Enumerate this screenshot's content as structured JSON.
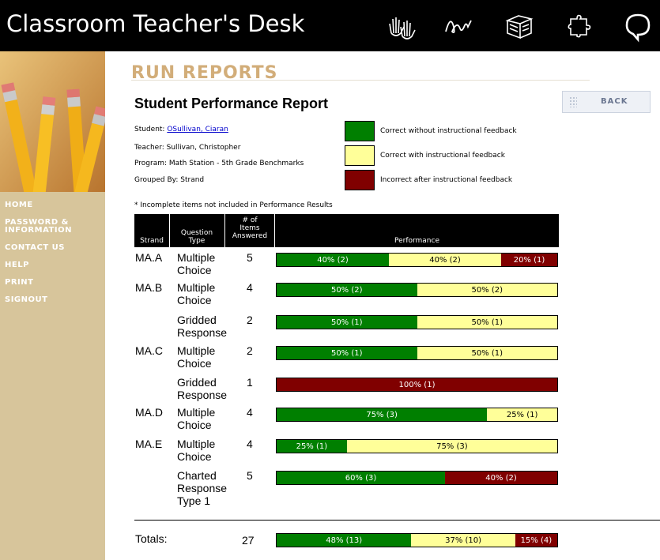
{
  "header": {
    "title": "Classroom Teacher's Desk",
    "icons": [
      "hands-icon",
      "signature-icon",
      "books-icon",
      "puzzle-icon",
      "speech-bubble-icon"
    ]
  },
  "sidebar": {
    "items": [
      {
        "label": "HOME"
      },
      {
        "label": "PASSWORD & INFORMATION"
      },
      {
        "label": "CONTACT US"
      },
      {
        "label": "HELP"
      },
      {
        "label": "PRINT"
      },
      {
        "label": "SIGNOUT"
      }
    ]
  },
  "page": {
    "section_title": "RUN REPORTS",
    "report_title": "Student Performance Report",
    "back_label": "BACK"
  },
  "meta": {
    "student_label": "Student:",
    "student_name": "OSullivan, Ciaran",
    "teacher": "Teacher: Sullivan, Christopher",
    "program": "Program: Math Station - 5th Grade Benchmarks",
    "grouped_by": "Grouped By: Strand",
    "note": "* Incomplete items not included in Performance Results"
  },
  "legend": [
    {
      "label": "Correct without instructional feedback",
      "color": "#007f00"
    },
    {
      "label": "Correct with instructional feedback",
      "color": "#ffff99"
    },
    {
      "label": "Incorrect after instructional feedback",
      "color": "#800000"
    }
  ],
  "colors": {
    "green": "#007f00",
    "yellow": "#ffff99",
    "red": "#800000"
  },
  "table": {
    "headers": {
      "strand": "Strand",
      "question_type_1": "Question",
      "question_type_2": "Type",
      "items_1": "# of",
      "items_2": "Items",
      "items_3": "Answered",
      "performance": "Performance"
    },
    "rows": [
      {
        "strand": "MA.A",
        "type": [
          "Multiple",
          "Choice"
        ],
        "count": "5",
        "segments": [
          {
            "pct": 40,
            "label": "40%  (2)",
            "kind": "green"
          },
          {
            "pct": 40,
            "label": "40%  (2)",
            "kind": "yellow"
          },
          {
            "pct": 20,
            "label": "20%  (1)",
            "kind": "red"
          }
        ]
      },
      {
        "strand": "MA.B",
        "type": [
          "Multiple",
          "Choice"
        ],
        "count": "4",
        "segments": [
          {
            "pct": 50,
            "label": "50%  (2)",
            "kind": "green"
          },
          {
            "pct": 50,
            "label": "50%  (2)",
            "kind": "yellow"
          }
        ]
      },
      {
        "strand": "",
        "type": [
          "Gridded",
          "Response"
        ],
        "count": "2",
        "segments": [
          {
            "pct": 50,
            "label": "50%  (1)",
            "kind": "green"
          },
          {
            "pct": 50,
            "label": "50%  (1)",
            "kind": "yellow"
          }
        ]
      },
      {
        "strand": "MA.C",
        "type": [
          "Multiple",
          "Choice"
        ],
        "count": "2",
        "segments": [
          {
            "pct": 50,
            "label": "50%  (1)",
            "kind": "green"
          },
          {
            "pct": 50,
            "label": "50%  (1)",
            "kind": "yellow"
          }
        ]
      },
      {
        "strand": "",
        "type": [
          "Gridded",
          "Response"
        ],
        "count": "1",
        "segments": [
          {
            "pct": 100,
            "label": "100%  (1)",
            "kind": "red"
          }
        ]
      },
      {
        "strand": "MA.D",
        "type": [
          "Multiple",
          "Choice"
        ],
        "count": "4",
        "segments": [
          {
            "pct": 75,
            "label": "75%  (3)",
            "kind": "green"
          },
          {
            "pct": 25,
            "label": "25%  (1)",
            "kind": "yellow"
          }
        ]
      },
      {
        "strand": "MA.E",
        "type": [
          "Multiple",
          "Choice"
        ],
        "count": "4",
        "segments": [
          {
            "pct": 25,
            "label": "25%  (1)",
            "kind": "green"
          },
          {
            "pct": 75,
            "label": "75%  (3)",
            "kind": "yellow"
          }
        ]
      },
      {
        "strand": "",
        "type": [
          "Charted",
          "Response",
          "Type 1"
        ],
        "count": "5",
        "segments": [
          {
            "pct": 60,
            "label": "60%  (3)",
            "kind": "green"
          },
          {
            "pct": 40,
            "label": "40%  (2)",
            "kind": "red"
          }
        ]
      }
    ],
    "totals": {
      "label": "Totals:",
      "count": "27",
      "segments": [
        {
          "pct": 48,
          "label": "48%  (13)",
          "kind": "green"
        },
        {
          "pct": 37,
          "label": "37%  (10)",
          "kind": "yellow"
        },
        {
          "pct": 15,
          "label": "15%  (4)",
          "kind": "red"
        }
      ]
    }
  }
}
